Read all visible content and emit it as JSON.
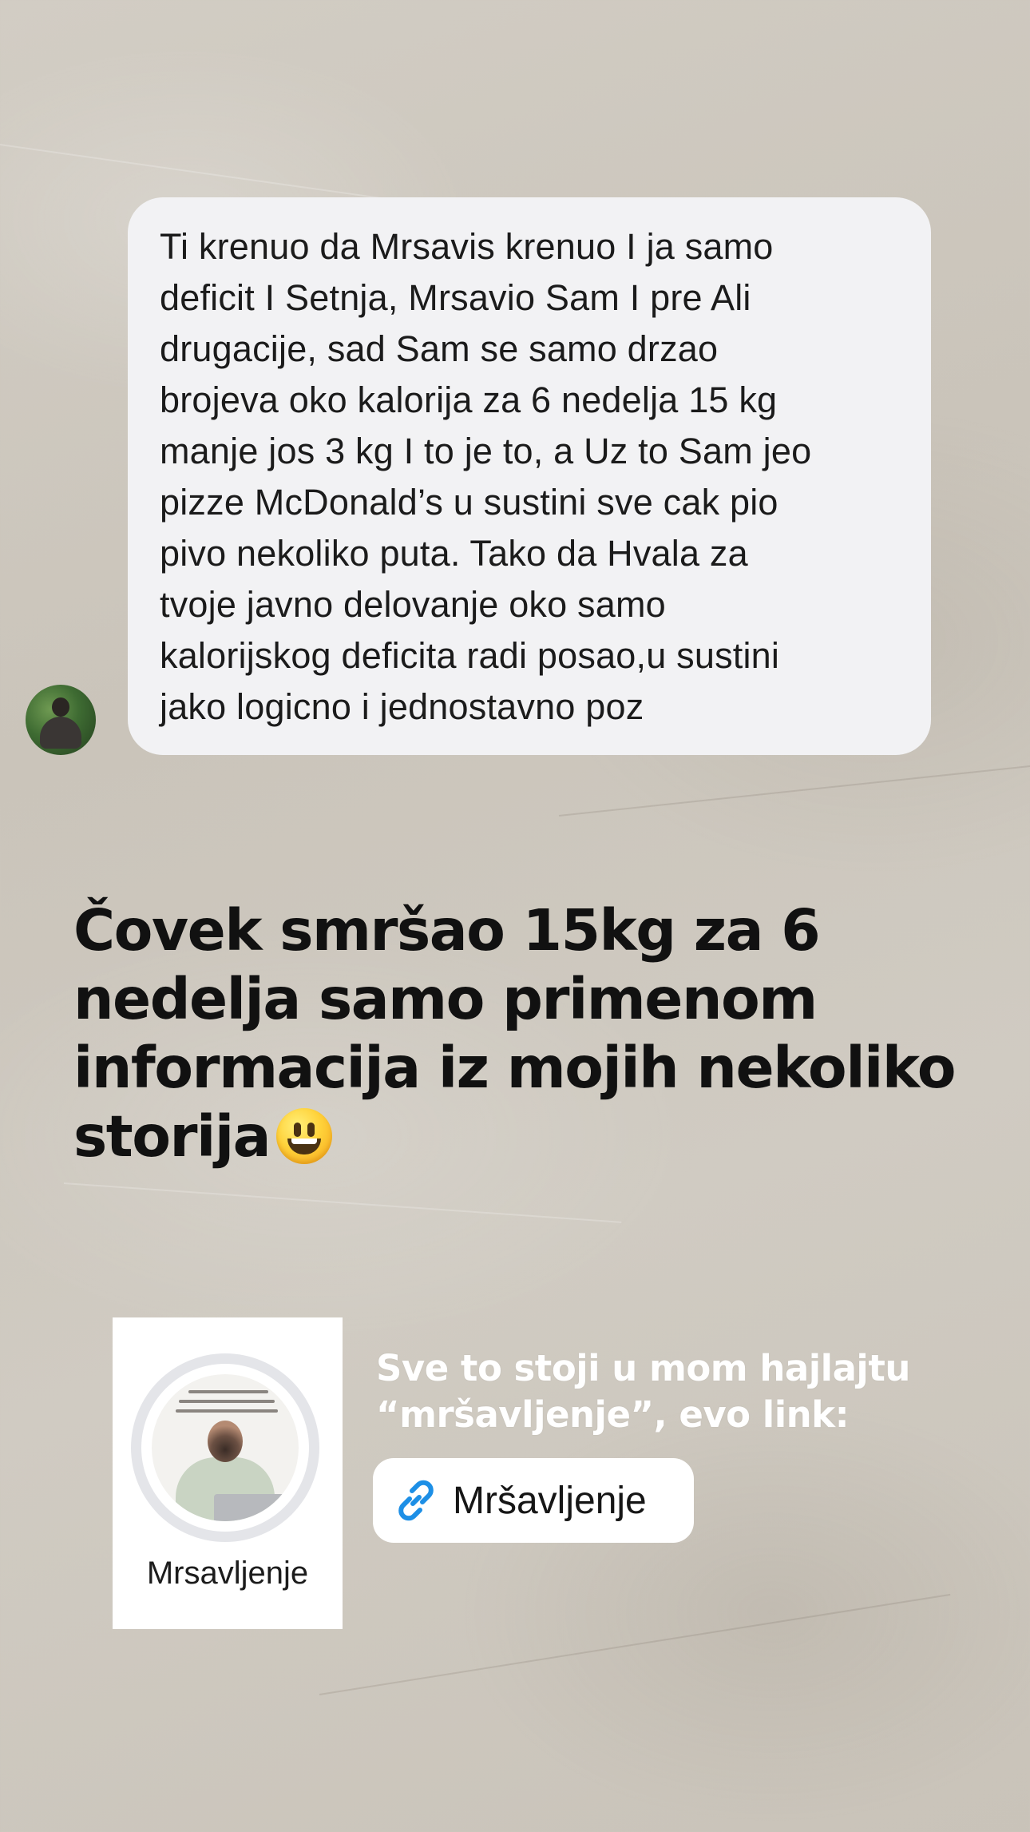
{
  "message": {
    "text_lines": [
      "Ti krenuo da Mrsavis krenuo I ja samo",
      "deficit I Setnja, Mrsavio Sam I pre Ali",
      "drugacije, sad Sam se samo drzao",
      "brojeva oko kalorija za 6 nedelja 15 kg",
      "manje jos 3 kg I to je to, a Uz to Sam jeo",
      "pizze McDonald’s u sustini sve cak pio",
      "pivo nekoliko puta. Tako da Hvala za",
      "tvoje javno delovanje oko samo",
      "kalorijskog deficita radi posao,u  sustini",
      "jako logicno i jednostavno poz"
    ]
  },
  "headline": {
    "text": "Čovek smršao 15kg za 6 nedelja samo primenom informacija iz mojih nekoliko storija",
    "emoji": "smiling-face-with-open-mouth"
  },
  "highlight": {
    "label": "Mrsavljenje"
  },
  "cta": {
    "text": "Sve to stoji u mom hajlajtu “mršavljenje”, evo link:"
  },
  "link_sticker": {
    "label": "Mršavljenje",
    "icon": "link-icon",
    "icon_color": "#1d8fe6"
  }
}
